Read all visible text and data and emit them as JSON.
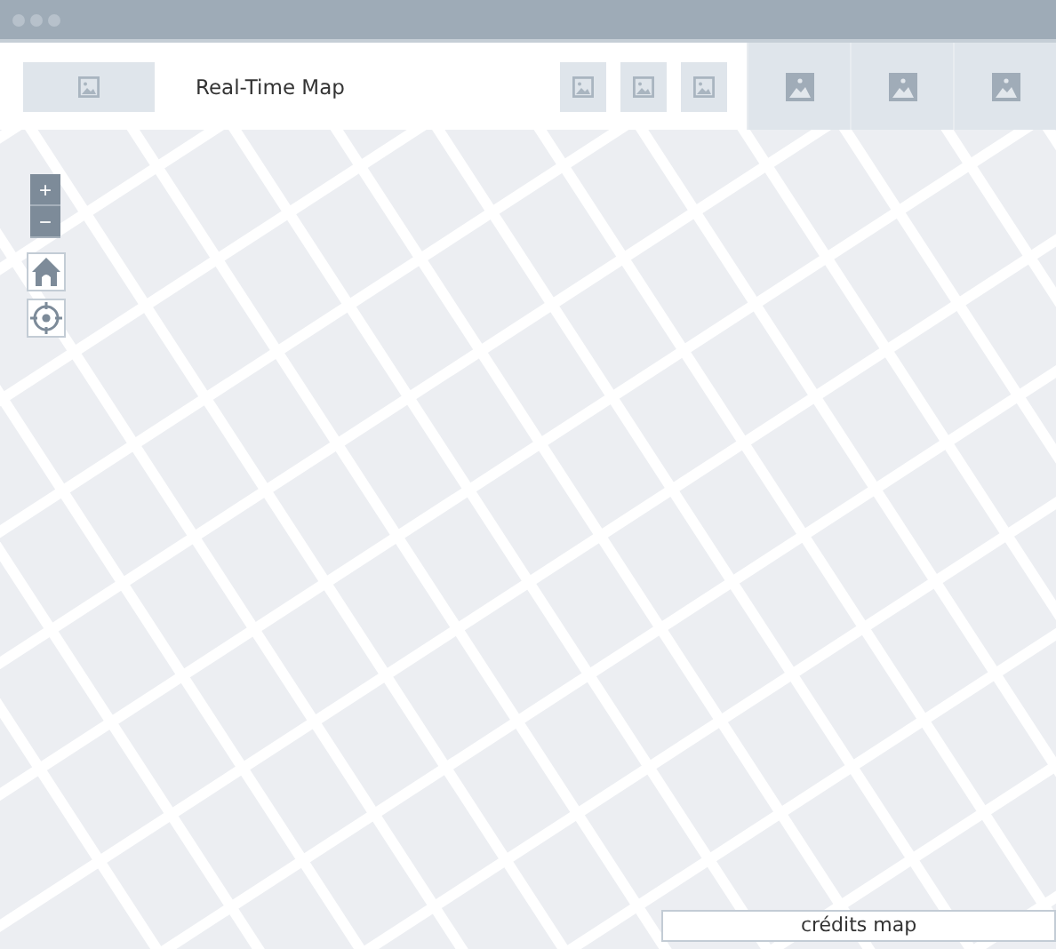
{
  "window": {
    "title": "Real-Time Map"
  },
  "map_controls": {
    "zoom_in": "+",
    "zoom_out": "−"
  },
  "credits": "crédits map"
}
